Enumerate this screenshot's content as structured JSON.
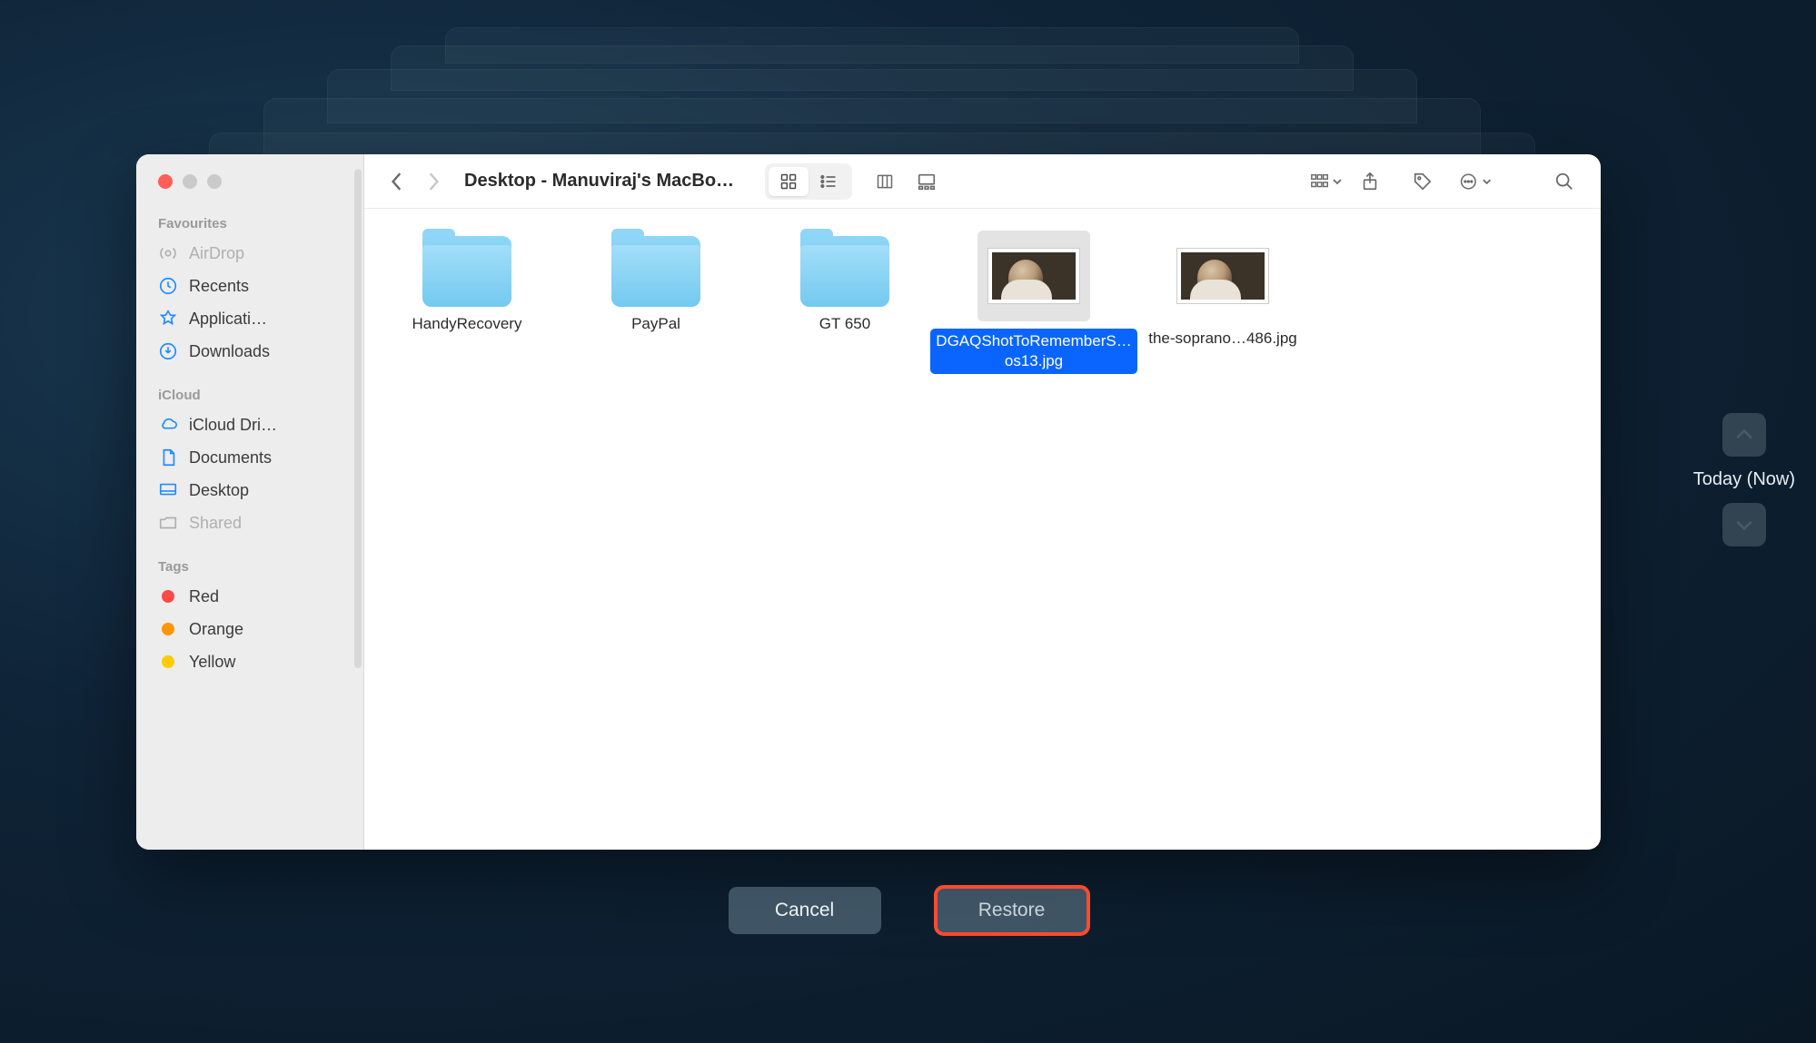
{
  "window": {
    "title": "Desktop - Manuviraj's MacBo…"
  },
  "sidebar": {
    "sections": [
      {
        "title": "Favourites",
        "items": [
          {
            "label": "AirDrop",
            "icon": "airdrop"
          },
          {
            "label": "Recents",
            "icon": "recents"
          },
          {
            "label": "Applicati…",
            "icon": "applications"
          },
          {
            "label": "Downloads",
            "icon": "downloads"
          }
        ]
      },
      {
        "title": "iCloud",
        "items": [
          {
            "label": "iCloud Dri…",
            "icon": "icloud"
          },
          {
            "label": "Documents",
            "icon": "documents"
          },
          {
            "label": "Desktop",
            "icon": "desktop"
          },
          {
            "label": "Shared",
            "icon": "shared"
          }
        ]
      },
      {
        "title": "Tags",
        "items": [
          {
            "label": "Red",
            "color": "#ff4b47"
          },
          {
            "label": "Orange",
            "color": "#ff9500"
          },
          {
            "label": "Yellow",
            "color": "#ffcc00"
          }
        ]
      }
    ]
  },
  "files": [
    {
      "name": "HandyRecovery",
      "type": "folder"
    },
    {
      "name": "PayPal",
      "type": "folder"
    },
    {
      "name": "GT 650",
      "type": "folder"
    },
    {
      "name": "DGAQShotToRememberS…os13.jpg",
      "type": "image",
      "selected": true
    },
    {
      "name": "the-soprano…486.jpg",
      "type": "image"
    }
  ],
  "timeline": {
    "label": "Today (Now)"
  },
  "buttons": {
    "cancel": "Cancel",
    "restore": "Restore"
  }
}
